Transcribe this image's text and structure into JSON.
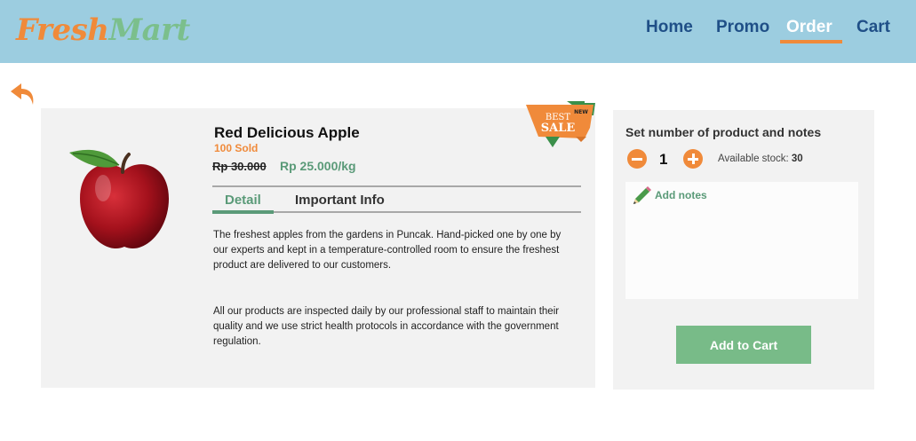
{
  "brand": {
    "part1": "Fresh",
    "part2": "Mart"
  },
  "nav": [
    {
      "label": "Home",
      "active": false
    },
    {
      "label": "Promo",
      "active": false
    },
    {
      "label": "Order",
      "active": true
    },
    {
      "label": "Cart",
      "active": false
    }
  ],
  "product": {
    "name": "Red Delicious Apple",
    "sold": "100 Sold",
    "old_price": "Rp 30.000",
    "price": "Rp 25.000/kg",
    "badge": {
      "line1": "BEST",
      "line2": "SALE",
      "tag": "NEW"
    },
    "image": "red-apple"
  },
  "tabs": [
    {
      "label": "Detail",
      "active": true
    },
    {
      "label": "Important Info",
      "active": false
    }
  ],
  "description": [
    "The freshest apples from the gardens in Puncak. Hand-picked one by one by our experts and kept in a temperature-controlled room to ensure the freshest product are delivered to our customers.",
    "All our products are inspected daily by our professional staff to maintain their quality and we use strict health protocols in accordance with the government regulation."
  ],
  "order": {
    "title": "Set number of product and notes",
    "quantity": "1",
    "stock_label": "Available stock: ",
    "stock_value": "30",
    "notes_label": "Add notes",
    "add_to_cart": "Add to Cart"
  },
  "icons": {
    "back": "back-arrow-icon",
    "minus": "minus-circle-icon",
    "plus": "plus-circle-icon",
    "notes": "pencil-icon"
  },
  "colors": {
    "header": "#9ccde0",
    "nav_text": "#1f4f87",
    "accent_orange": "#f08a3a",
    "accent_green": "#5a9a78",
    "button_green": "#78bb88",
    "panel": "#f2f2f2"
  }
}
